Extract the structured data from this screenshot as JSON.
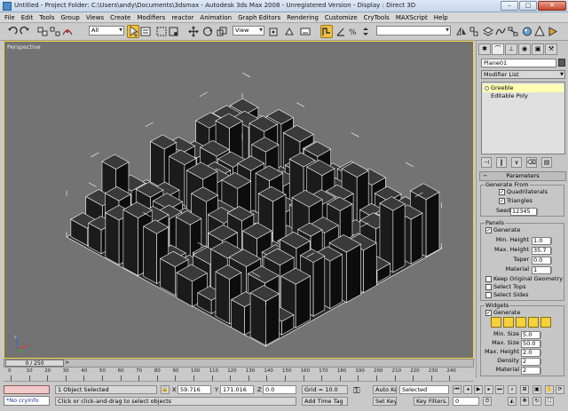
{
  "titlebar": {
    "title": "Untitled     - Project Folder: C:\\Users\\andy\\Documents\\3dsmax     - Autodesk 3ds Max 2008     - Unregistered Version     - Display : Direct 3D",
    "minimize": "–",
    "maximize": "□",
    "close": "✕"
  },
  "menubar": {
    "items": [
      "File",
      "Edit",
      "Tools",
      "Group",
      "Views",
      "Create",
      "Modifiers",
      "reactor",
      "Animation",
      "Graph Editors",
      "Rendering",
      "Customize",
      "CryTools",
      "MAXScript",
      "Help"
    ]
  },
  "toolbar": {
    "selection_filter": "All",
    "ref_coord": "View",
    "named_selection": ""
  },
  "viewport": {
    "label": "Perspective"
  },
  "command_panel": {
    "object_name": "Plane01",
    "modifier_list": "Modifier List",
    "stack": [
      "Greeble",
      "Editable Poly"
    ],
    "parameters_rollout": "Parameters",
    "generate_from": {
      "title": "Generate From",
      "quadrilaterals": "Quadrilaterals",
      "triangles": "Triangles",
      "seed_label": "Seed:",
      "seed_value": "12345"
    },
    "panels": {
      "title": "Panels",
      "generate": "Generate",
      "min_height_label": "Min. Height",
      "min_height": "1.0",
      "max_height_label": "Max. Height",
      "max_height": "35.7",
      "taper_label": "Taper",
      "taper": "0.0",
      "material_label": "Material",
      "material": "1",
      "keep_original": "Keep Original Geometry",
      "select_tops": "Select Tops",
      "select_sides": "Select Sides"
    },
    "widgets": {
      "title": "Widgets",
      "generate": "Generate",
      "min_size_label": "Min. Size",
      "min_size": "5.0",
      "max_size_label": "Max. Size",
      "max_size": "50.0",
      "max_height_label": "Max. Height",
      "max_height": "2.0",
      "density_label": "Density",
      "density": "2",
      "material_label": "Material",
      "material": "2"
    }
  },
  "timeline": {
    "slider": "0 / 250",
    "ticks": [
      "0",
      "10",
      "20",
      "30",
      "40",
      "50",
      "60",
      "70",
      "80",
      "90",
      "100",
      "110",
      "120",
      "130",
      "140",
      "150",
      "160",
      "170",
      "180",
      "190",
      "200",
      "210",
      "220",
      "230",
      "240"
    ]
  },
  "status": {
    "objects_selected": "1 Object Selected",
    "prompt": "Click or click-and-drag to select objects",
    "x_label": "X",
    "x_value": "59.716",
    "y_label": "Y",
    "y_value": "171.016",
    "z_label": "Z",
    "z_value": "0.0",
    "grid": "Grid = 10.0",
    "add_time_tag": "Add Time Tag",
    "auto_key": "Auto Key",
    "set_key": "Set Key",
    "key_mode": "Selected",
    "key_filters": "Key Filters...",
    "frame": "0",
    "maxscript_hint": "*No cryInfo"
  },
  "colors": {
    "viewport_bg": "#737373",
    "active_border": "#f5d23a",
    "selected_modifier": "#ffffb2"
  }
}
